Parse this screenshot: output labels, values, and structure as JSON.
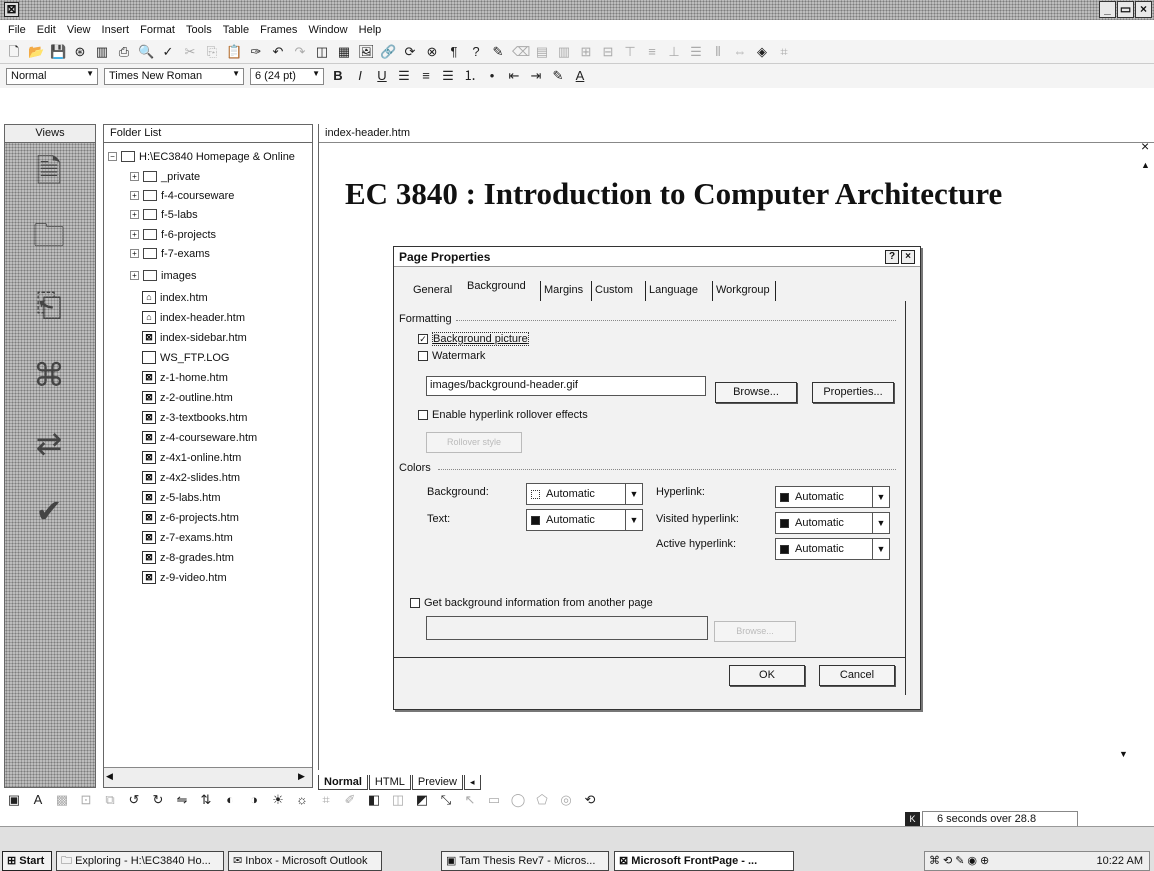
{
  "menus": [
    "File",
    "Edit",
    "View",
    "Insert",
    "Format",
    "Tools",
    "Table",
    "Frames",
    "Window",
    "Help"
  ],
  "formatting": {
    "style": "Normal",
    "font": "Times New Roman",
    "size": "6 (24 pt)"
  },
  "views_panel": {
    "title": "Views"
  },
  "folder_list": {
    "title": "Folder List",
    "root": "H:\\EC3840 Homepage & Online",
    "items": [
      "_private",
      "f-4-courseware",
      "f-5-labs",
      "f-6-projects",
      "f-7-exams",
      "images",
      "index.htm",
      "index-header.htm",
      "index-sidebar.htm",
      "WS_FTP.LOG",
      "z-1-home.htm",
      "z-2-outline.htm",
      "z-3-textbooks.htm",
      "z-4-courseware.htm",
      "z-4x1-online.htm",
      "z-4x2-slides.htm",
      "z-5-labs.htm",
      "z-6-projects.htm",
      "z-7-exams.htm",
      "z-8-grades.htm",
      "z-9-video.htm"
    ]
  },
  "editor": {
    "tab_label": "index-header.htm",
    "heading": "EC 3840 : Introduction to Computer Architecture"
  },
  "dialog": {
    "title": "Page Properties",
    "tabs": [
      "General",
      "Background",
      "Margins",
      "Custom",
      "Language",
      "Workgroup"
    ],
    "formatting_label": "Formatting",
    "background_picture": "Background picture",
    "watermark": "Watermark",
    "image_path": "images/background-header.gif",
    "browse": "Browse...",
    "properties": "Properties...",
    "rollover": "Enable hyperlink rollover effects",
    "rollover_style": "Rollover style",
    "colors_label": "Colors",
    "background_label": "Background:",
    "text_label": "Text:",
    "hyperlink_label": "Hyperlink:",
    "visited_label": "Visited hyperlink:",
    "active_label": "Active hyperlink:",
    "automatic": "Automatic",
    "get_background": "Get background information from another page",
    "browse2": "Browse...",
    "ok": "OK",
    "cancel": "Cancel"
  },
  "view_tabs": [
    "Normal",
    "HTML",
    "Preview"
  ],
  "taskbar": {
    "start": "Start",
    "tasks": [
      "Exploring - H:\\EC3840 Ho...",
      "Inbox - Microsoft Outlook",
      "Tam Thesis Rev7 - Micros...",
      "Microsoft FrontPage - ..."
    ],
    "status": "6 seconds over 28.8",
    "clock": "10:22 AM"
  }
}
